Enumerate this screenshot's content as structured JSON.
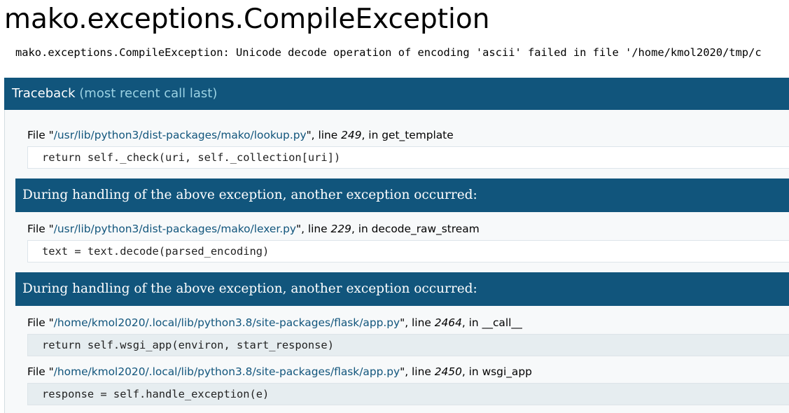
{
  "page": {
    "title": "mako.exceptions.CompileException",
    "error_message": "mako.exceptions.CompileException: Unicode decode operation of encoding 'ascii' failed in file '/home/kmol2020/tmp/c"
  },
  "traceback": {
    "header_label": "Traceback",
    "header_recent": "(most recent call last)",
    "divider_text": "During handling of the above exception, another exception occurred:",
    "frames": [
      {
        "file_prefix": "File \"",
        "filename": "/usr/lib/python3/dist-packages/mako/lookup.py",
        "line_prefix": "\", line ",
        "lineno": "249",
        "in_prefix": ", in ",
        "function": "get_template",
        "source": "return self._check(uri, self._collection[uri])"
      },
      {
        "file_prefix": "File \"",
        "filename": "/usr/lib/python3/dist-packages/mako/lexer.py",
        "line_prefix": "\", line ",
        "lineno": "229",
        "in_prefix": ", in ",
        "function": "decode_raw_stream",
        "source": "text = text.decode(parsed_encoding)"
      },
      {
        "file_prefix": "File \"",
        "filename": "/home/kmol2020/.local/lib/python3.8/site-packages/flask/app.py",
        "line_prefix": "\", line ",
        "lineno": "2464",
        "in_prefix": ", in ",
        "function": "__call__",
        "source": "return self.wsgi_app(environ, start_response)"
      },
      {
        "file_prefix": "File \"",
        "filename": "/home/kmol2020/.local/lib/python3.8/site-packages/flask/app.py",
        "line_prefix": "\", line ",
        "lineno": "2450",
        "in_prefix": ", in ",
        "function": "wsgi_app",
        "source": "response = self.handle_exception(e)"
      }
    ]
  },
  "colors": {
    "header_bg": "#11557c",
    "header_text": "#ffffff",
    "recent_call_text": "#9bd2e3",
    "filename_text": "#11557c"
  }
}
